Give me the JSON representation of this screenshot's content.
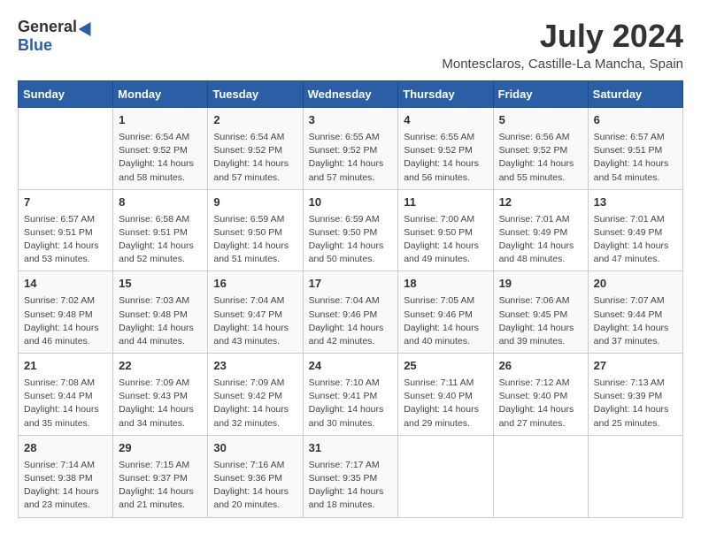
{
  "logo": {
    "general": "General",
    "blue": "Blue"
  },
  "title": {
    "month_year": "July 2024",
    "location": "Montesclaros, Castille-La Mancha, Spain"
  },
  "calendar": {
    "headers": [
      "Sunday",
      "Monday",
      "Tuesday",
      "Wednesday",
      "Thursday",
      "Friday",
      "Saturday"
    ],
    "rows": [
      [
        {
          "day": "",
          "info": ""
        },
        {
          "day": "1",
          "info": "Sunrise: 6:54 AM\nSunset: 9:52 PM\nDaylight: 14 hours\nand 58 minutes."
        },
        {
          "day": "2",
          "info": "Sunrise: 6:54 AM\nSunset: 9:52 PM\nDaylight: 14 hours\nand 57 minutes."
        },
        {
          "day": "3",
          "info": "Sunrise: 6:55 AM\nSunset: 9:52 PM\nDaylight: 14 hours\nand 57 minutes."
        },
        {
          "day": "4",
          "info": "Sunrise: 6:55 AM\nSunset: 9:52 PM\nDaylight: 14 hours\nand 56 minutes."
        },
        {
          "day": "5",
          "info": "Sunrise: 6:56 AM\nSunset: 9:52 PM\nDaylight: 14 hours\nand 55 minutes."
        },
        {
          "day": "6",
          "info": "Sunrise: 6:57 AM\nSunset: 9:51 PM\nDaylight: 14 hours\nand 54 minutes."
        }
      ],
      [
        {
          "day": "7",
          "info": "Sunrise: 6:57 AM\nSunset: 9:51 PM\nDaylight: 14 hours\nand 53 minutes."
        },
        {
          "day": "8",
          "info": "Sunrise: 6:58 AM\nSunset: 9:51 PM\nDaylight: 14 hours\nand 52 minutes."
        },
        {
          "day": "9",
          "info": "Sunrise: 6:59 AM\nSunset: 9:50 PM\nDaylight: 14 hours\nand 51 minutes."
        },
        {
          "day": "10",
          "info": "Sunrise: 6:59 AM\nSunset: 9:50 PM\nDaylight: 14 hours\nand 50 minutes."
        },
        {
          "day": "11",
          "info": "Sunrise: 7:00 AM\nSunset: 9:50 PM\nDaylight: 14 hours\nand 49 minutes."
        },
        {
          "day": "12",
          "info": "Sunrise: 7:01 AM\nSunset: 9:49 PM\nDaylight: 14 hours\nand 48 minutes."
        },
        {
          "day": "13",
          "info": "Sunrise: 7:01 AM\nSunset: 9:49 PM\nDaylight: 14 hours\nand 47 minutes."
        }
      ],
      [
        {
          "day": "14",
          "info": "Sunrise: 7:02 AM\nSunset: 9:48 PM\nDaylight: 14 hours\nand 46 minutes."
        },
        {
          "day": "15",
          "info": "Sunrise: 7:03 AM\nSunset: 9:48 PM\nDaylight: 14 hours\nand 44 minutes."
        },
        {
          "day": "16",
          "info": "Sunrise: 7:04 AM\nSunset: 9:47 PM\nDaylight: 14 hours\nand 43 minutes."
        },
        {
          "day": "17",
          "info": "Sunrise: 7:04 AM\nSunset: 9:46 PM\nDaylight: 14 hours\nand 42 minutes."
        },
        {
          "day": "18",
          "info": "Sunrise: 7:05 AM\nSunset: 9:46 PM\nDaylight: 14 hours\nand 40 minutes."
        },
        {
          "day": "19",
          "info": "Sunrise: 7:06 AM\nSunset: 9:45 PM\nDaylight: 14 hours\nand 39 minutes."
        },
        {
          "day": "20",
          "info": "Sunrise: 7:07 AM\nSunset: 9:44 PM\nDaylight: 14 hours\nand 37 minutes."
        }
      ],
      [
        {
          "day": "21",
          "info": "Sunrise: 7:08 AM\nSunset: 9:44 PM\nDaylight: 14 hours\nand 35 minutes."
        },
        {
          "day": "22",
          "info": "Sunrise: 7:09 AM\nSunset: 9:43 PM\nDaylight: 14 hours\nand 34 minutes."
        },
        {
          "day": "23",
          "info": "Sunrise: 7:09 AM\nSunset: 9:42 PM\nDaylight: 14 hours\nand 32 minutes."
        },
        {
          "day": "24",
          "info": "Sunrise: 7:10 AM\nSunset: 9:41 PM\nDaylight: 14 hours\nand 30 minutes."
        },
        {
          "day": "25",
          "info": "Sunrise: 7:11 AM\nSunset: 9:40 PM\nDaylight: 14 hours\nand 29 minutes."
        },
        {
          "day": "26",
          "info": "Sunrise: 7:12 AM\nSunset: 9:40 PM\nDaylight: 14 hours\nand 27 minutes."
        },
        {
          "day": "27",
          "info": "Sunrise: 7:13 AM\nSunset: 9:39 PM\nDaylight: 14 hours\nand 25 minutes."
        }
      ],
      [
        {
          "day": "28",
          "info": "Sunrise: 7:14 AM\nSunset: 9:38 PM\nDaylight: 14 hours\nand 23 minutes."
        },
        {
          "day": "29",
          "info": "Sunrise: 7:15 AM\nSunset: 9:37 PM\nDaylight: 14 hours\nand 21 minutes."
        },
        {
          "day": "30",
          "info": "Sunrise: 7:16 AM\nSunset: 9:36 PM\nDaylight: 14 hours\nand 20 minutes."
        },
        {
          "day": "31",
          "info": "Sunrise: 7:17 AM\nSunset: 9:35 PM\nDaylight: 14 hours\nand 18 minutes."
        },
        {
          "day": "",
          "info": ""
        },
        {
          "day": "",
          "info": ""
        },
        {
          "day": "",
          "info": ""
        }
      ]
    ]
  }
}
